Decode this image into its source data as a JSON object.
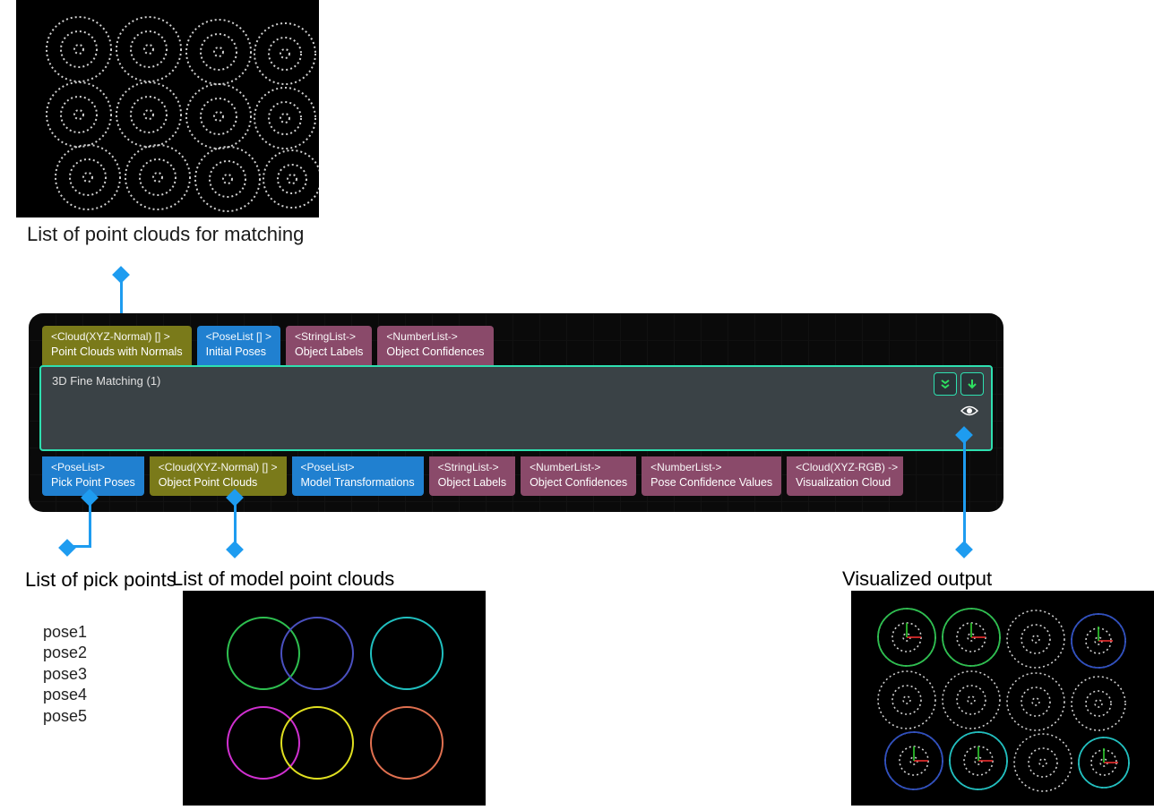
{
  "captions": {
    "pointclouds": "List of point clouds for matching",
    "pick_points": "List of pick points",
    "model_clouds": "List of model point clouds",
    "visualized": "Visualized output"
  },
  "node": {
    "title": "3D Fine Matching (1)",
    "inputs": [
      {
        "type": "<Cloud(XYZ-Normal) [] >",
        "name": "Point Clouds with Normals",
        "color": "c-olive"
      },
      {
        "type": "<PoseList [] >",
        "name": "Initial Poses",
        "color": "c-blue"
      },
      {
        "type": "<StringList->",
        "name": "Object Labels",
        "color": "c-purple"
      },
      {
        "type": "<NumberList->",
        "name": "Object Confidences",
        "color": "c-purple"
      }
    ],
    "outputs": [
      {
        "type": "<PoseList>",
        "name": "Pick Point Poses",
        "color": "c-blue"
      },
      {
        "type": "<Cloud(XYZ-Normal) [] >",
        "name": "Object Point Clouds",
        "color": "c-olive"
      },
      {
        "type": "<PoseList>",
        "name": "Model Transformations",
        "color": "c-blue"
      },
      {
        "type": "<StringList->",
        "name": "Object Labels",
        "color": "c-purple"
      },
      {
        "type": "<NumberList->",
        "name": "Object Confidences",
        "color": "c-purple"
      },
      {
        "type": "<NumberList->",
        "name": "Pose Confidence Values",
        "color": "c-purple"
      },
      {
        "type": "<Cloud(XYZ-RGB) ->",
        "name": "Visualization Cloud",
        "color": "c-purple"
      }
    ]
  },
  "poses": [
    "pose1",
    "pose2",
    "pose3",
    "pose4",
    "pose5"
  ],
  "colors": {
    "accent_blue": "#1e9cf0",
    "node_border": "#2ee0b0"
  }
}
